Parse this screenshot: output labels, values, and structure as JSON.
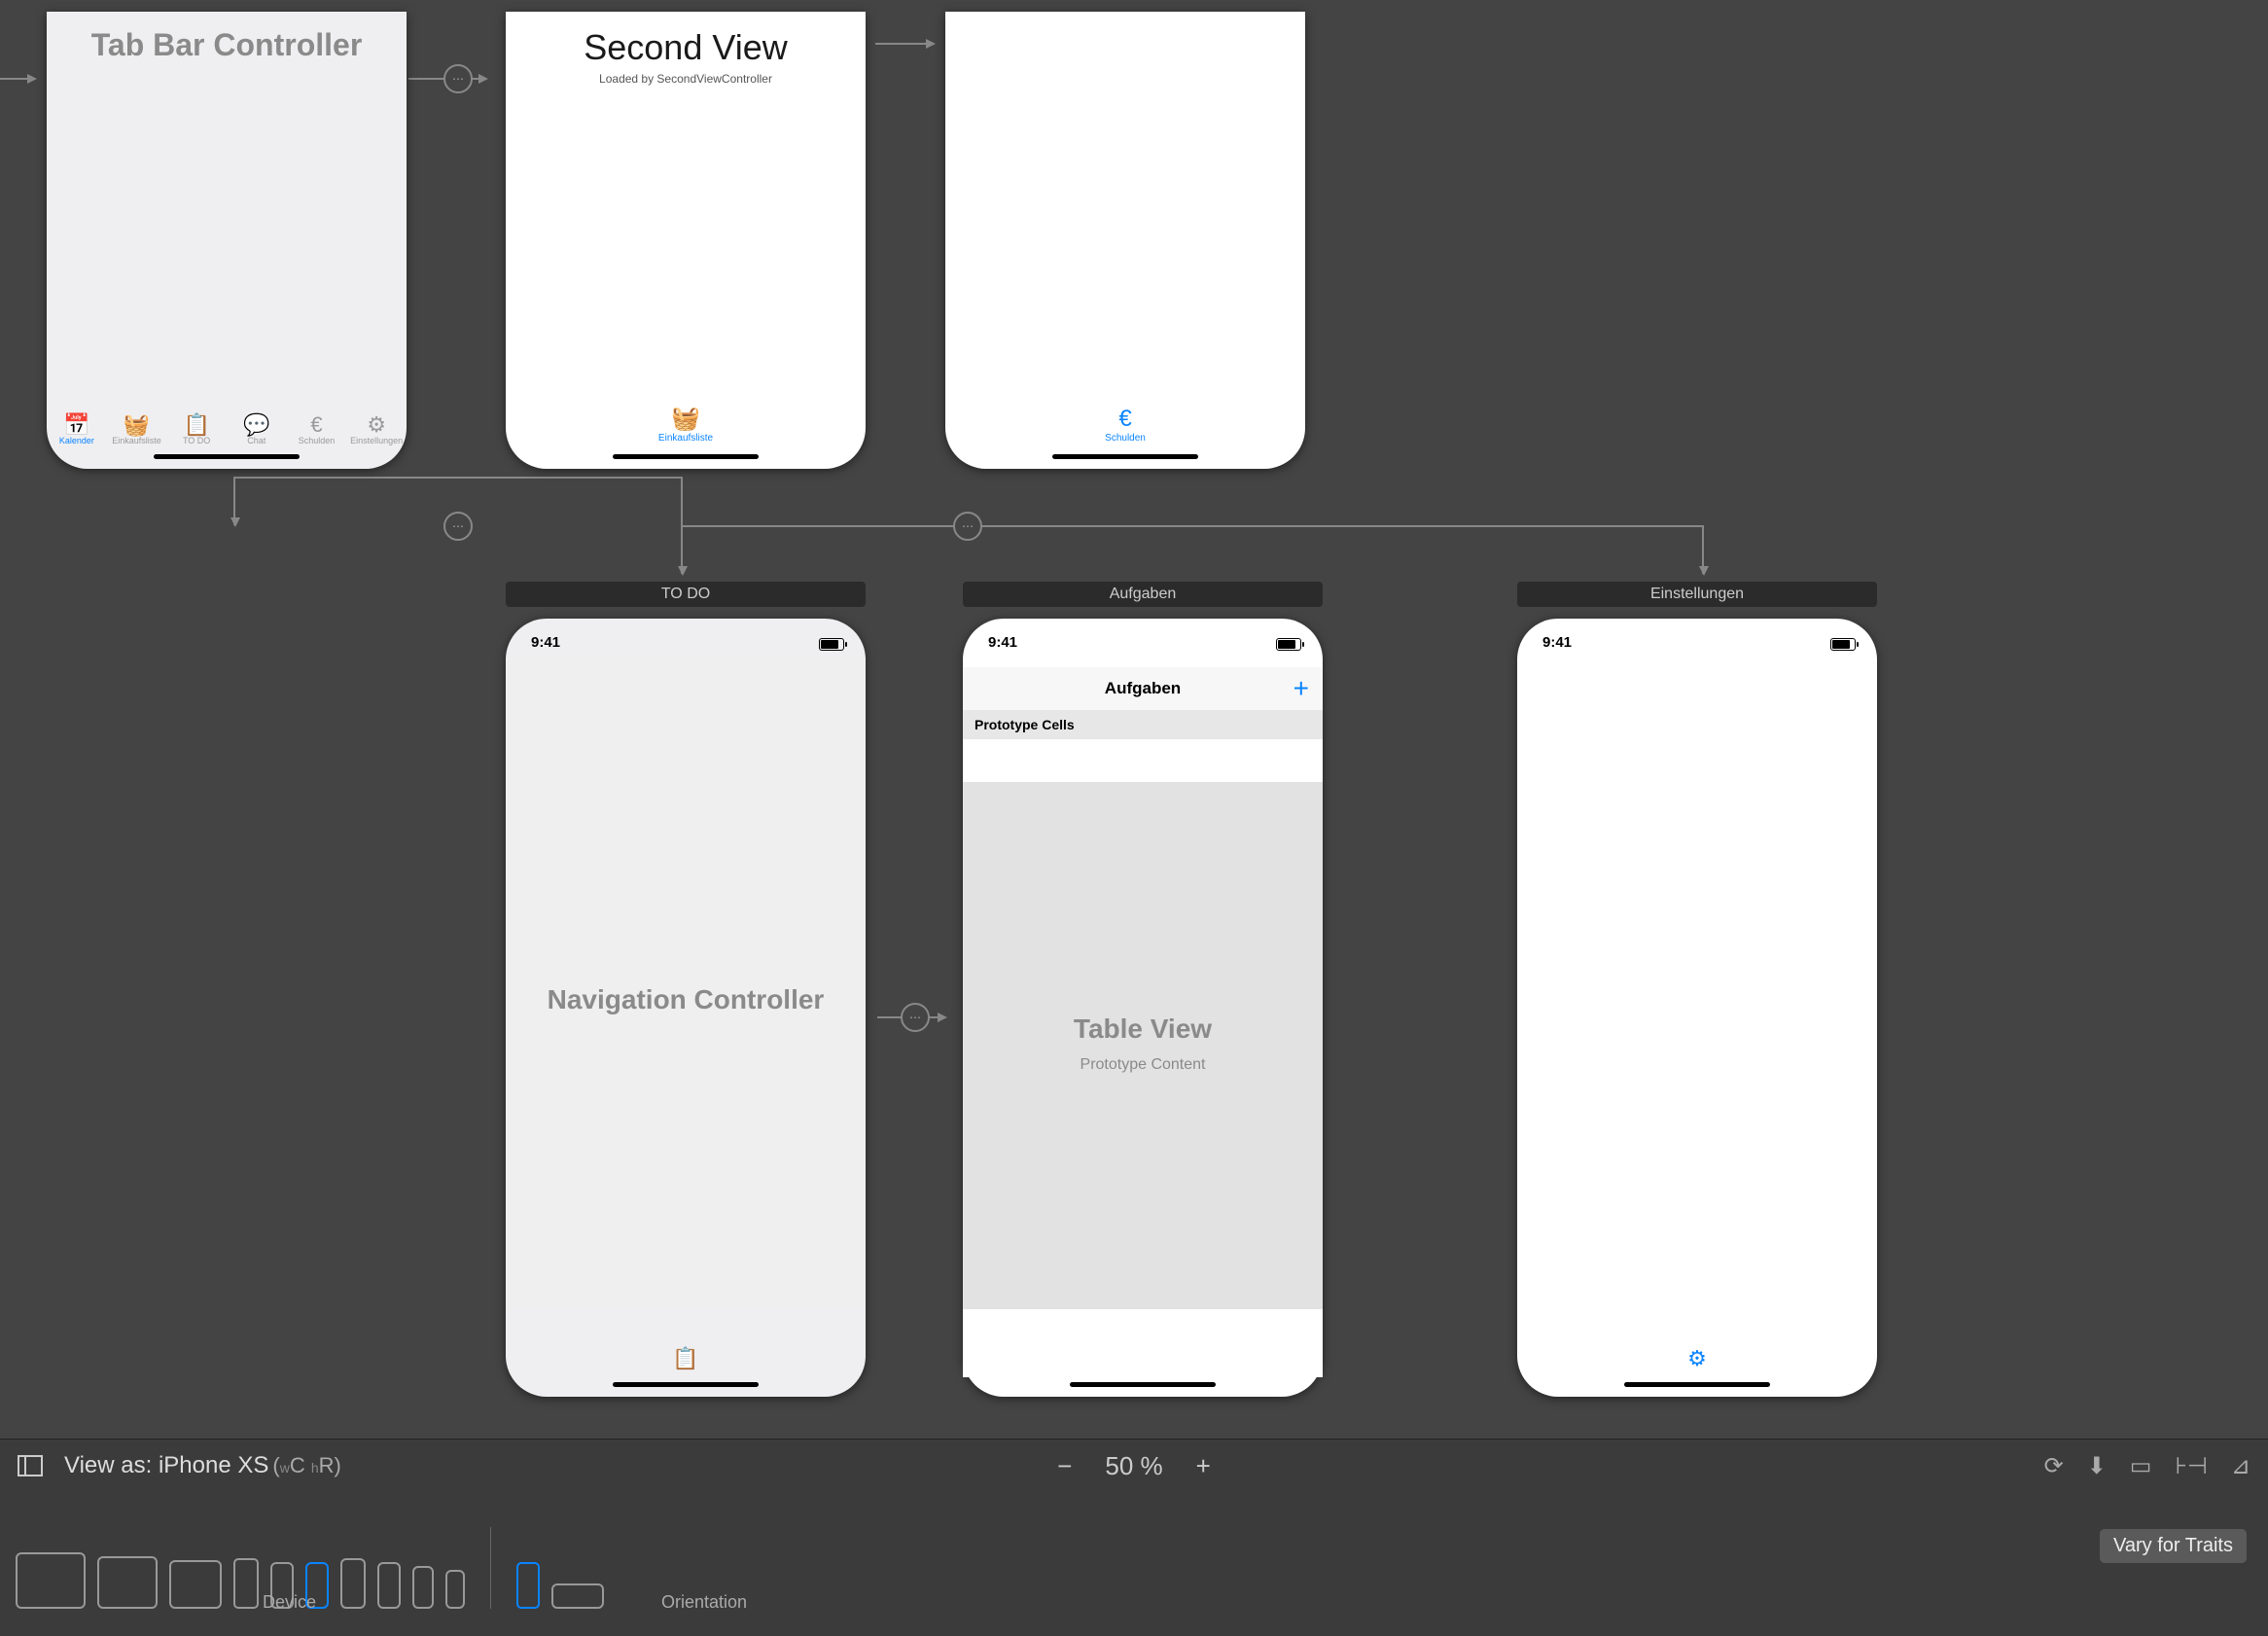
{
  "canvas": {
    "tabbar_controller_title": "Tab Bar Controller",
    "second_view": {
      "title": "Second View",
      "subtitle": "Loaded by SecondViewController"
    },
    "tab_items": [
      {
        "label": "Kalender",
        "icon": "📅"
      },
      {
        "label": "Einkaufsliste",
        "icon": "🧺"
      },
      {
        "label": "TO DO",
        "icon": "📋"
      },
      {
        "label": "Chat",
        "icon": "💬"
      },
      {
        "label": "Schulden",
        "icon": "€"
      },
      {
        "label": "Einstellungen",
        "icon": "⚙"
      }
    ],
    "second_tab": {
      "label": "Einkaufsliste",
      "icon": "🧺"
    },
    "third_tab": {
      "label": "Schulden",
      "icon": "€"
    },
    "scene_titles": {
      "todo": "TO DO",
      "aufgaben": "Aufgaben",
      "einstellungen": "Einstellungen"
    },
    "nav_ctrl_label": "Navigation Controller",
    "aufgaben": {
      "status_time": "9:41",
      "nav_title": "Aufgaben",
      "proto_header": "Prototype Cells",
      "center_label": "Table View",
      "center_sub": "Prototype Content"
    },
    "status_time": "9:41"
  },
  "bottombar": {
    "view_as": "View as: iPhone XS",
    "sizeclass_wc": "C",
    "sizeclass_hr": "R",
    "zoom_level": "50 %",
    "device_label": "Device",
    "orientation_label": "Orientation",
    "vary_button": "Vary for Traits"
  }
}
